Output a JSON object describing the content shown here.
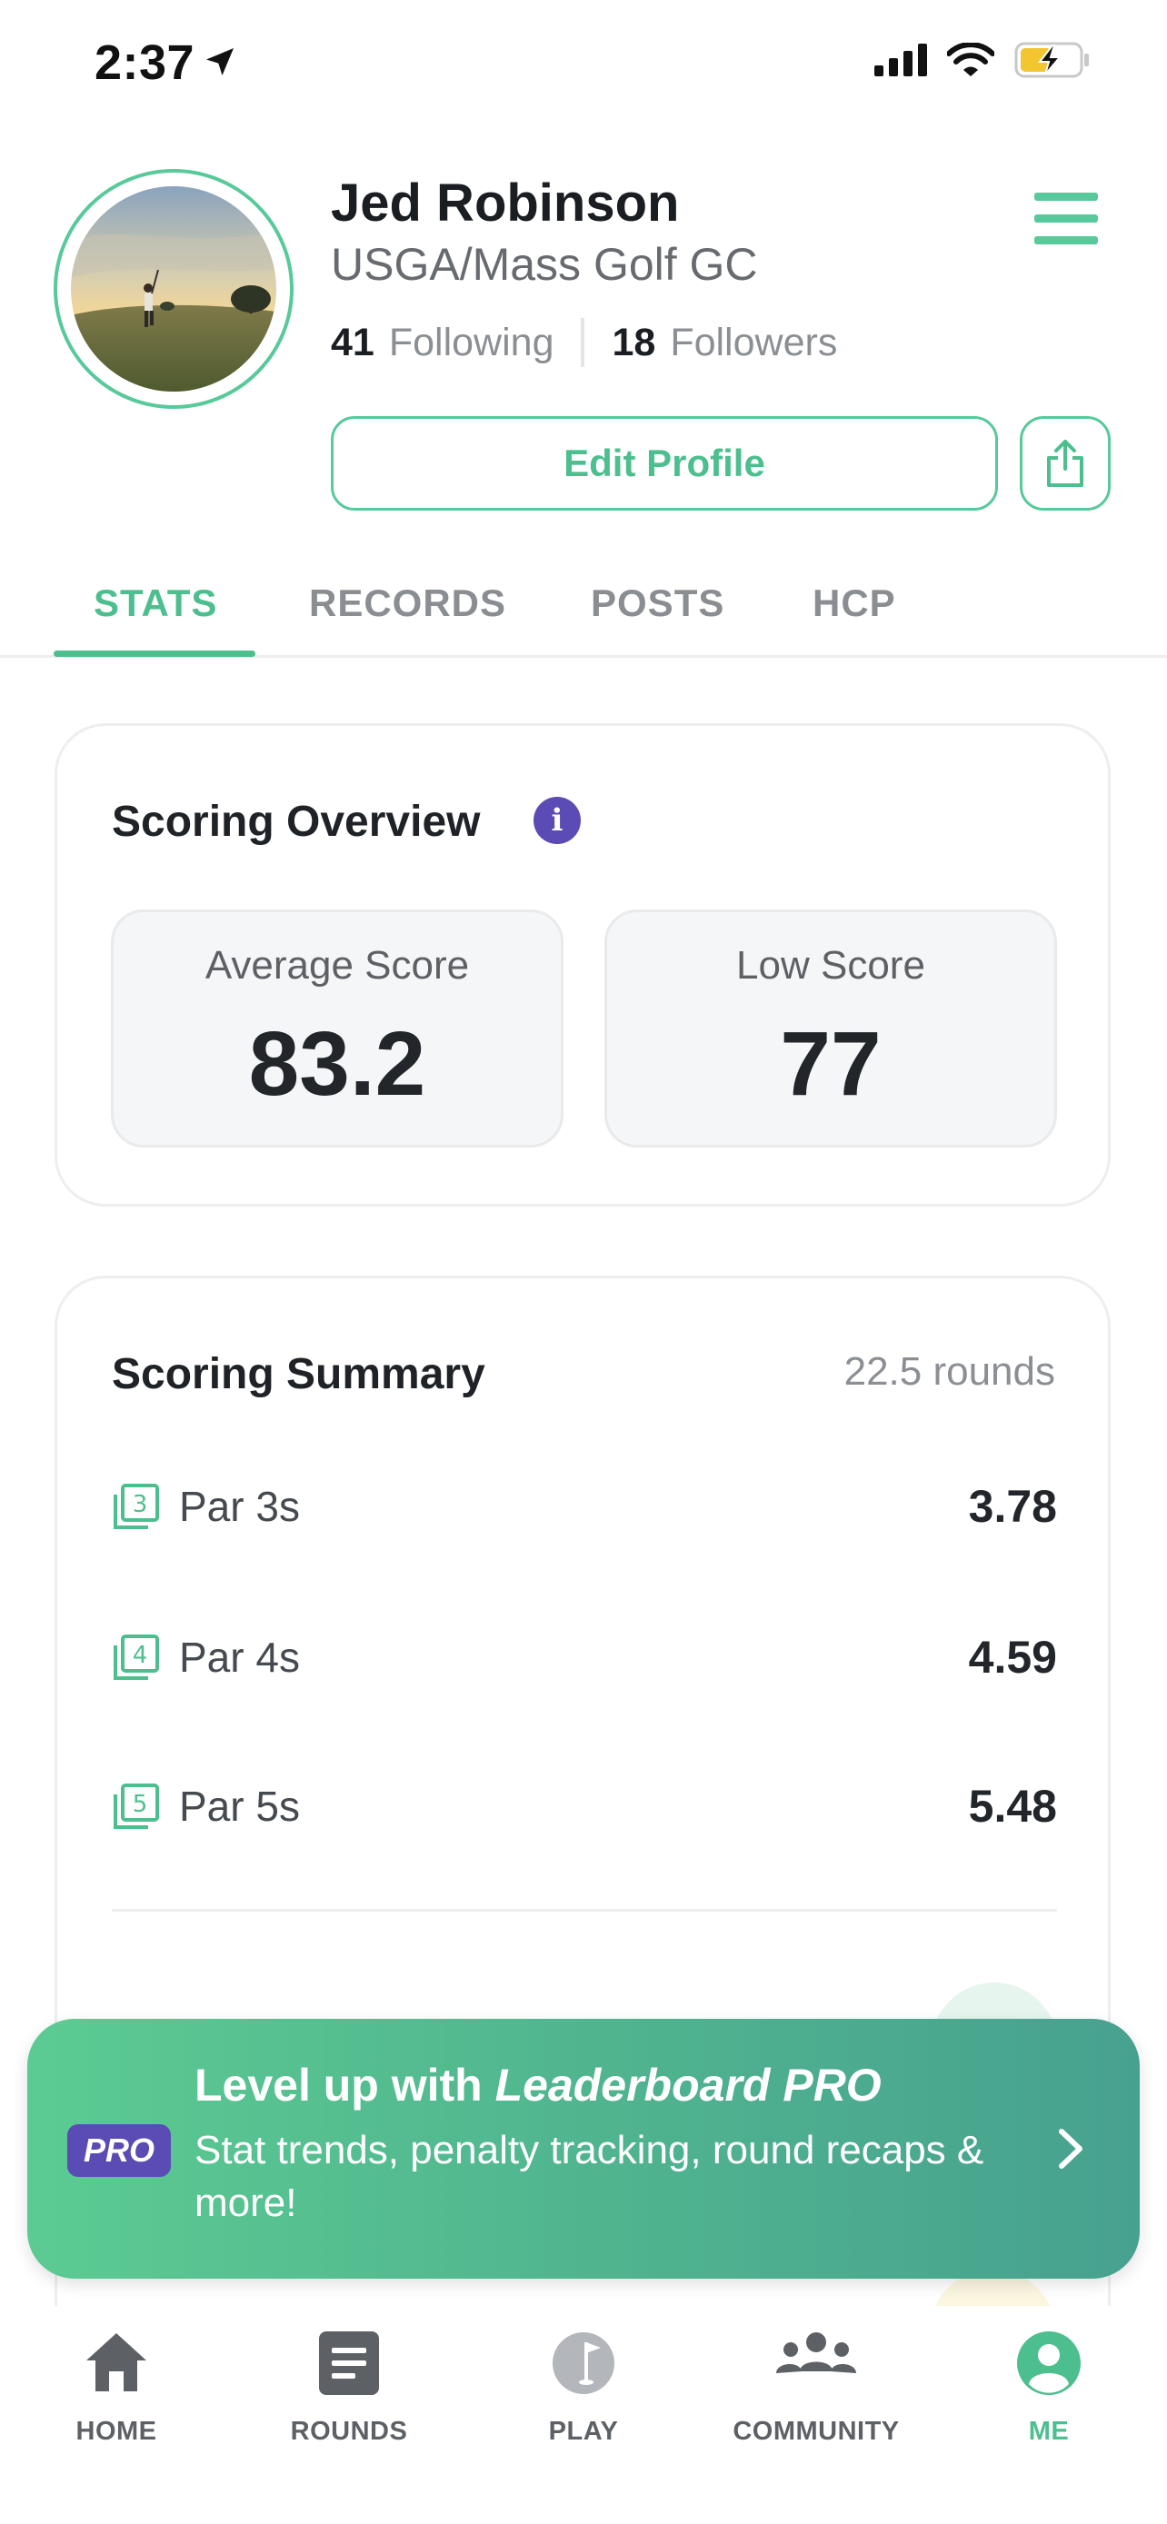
{
  "status_bar": {
    "time": "2:37"
  },
  "profile": {
    "name": "Jed Robinson",
    "club": "USGA/Mass Golf GC",
    "following_count": "41",
    "following_label": "Following",
    "followers_count": "18",
    "followers_label": "Followers",
    "edit_label": "Edit Profile"
  },
  "tabs": [
    {
      "label": "STATS",
      "active": true
    },
    {
      "label": "RECORDS",
      "active": false
    },
    {
      "label": "POSTS",
      "active": false
    },
    {
      "label": "HCP",
      "active": false
    }
  ],
  "scoring_overview": {
    "title": "Scoring Overview",
    "average_label": "Average Score",
    "average_value": "83.2",
    "low_label": "Low Score",
    "low_value": "77"
  },
  "scoring_summary": {
    "title": "Scoring Summary",
    "rounds": "22.5 rounds",
    "rows": [
      {
        "icon_num": "3",
        "label": "Par 3s",
        "value": "3.78"
      },
      {
        "icon_num": "4",
        "label": "Par 4s",
        "value": "4.59"
      },
      {
        "icon_num": "5",
        "label": "Par 5s",
        "value": "5.48"
      }
    ]
  },
  "promo": {
    "badge": "PRO",
    "title_prefix": "Level up with ",
    "title_brand": "Leaderboard PRO",
    "description": "Stat trends, penalty tracking, round recaps & more!"
  },
  "bottom_nav": [
    {
      "label": "HOME",
      "icon": "home-icon",
      "active": false
    },
    {
      "label": "ROUNDS",
      "icon": "rounds-icon",
      "active": false
    },
    {
      "label": "PLAY",
      "icon": "golf-ball-flag-icon",
      "active": false
    },
    {
      "label": "COMMUNITY",
      "icon": "community-icon",
      "active": false
    },
    {
      "label": "ME",
      "icon": "profile-icon",
      "active": true
    }
  ],
  "colors": {
    "accent": "#4dbf8e",
    "pro_purple": "#5b4bb5",
    "promo_start": "#5ccb92",
    "promo_end": "#47a18f"
  }
}
